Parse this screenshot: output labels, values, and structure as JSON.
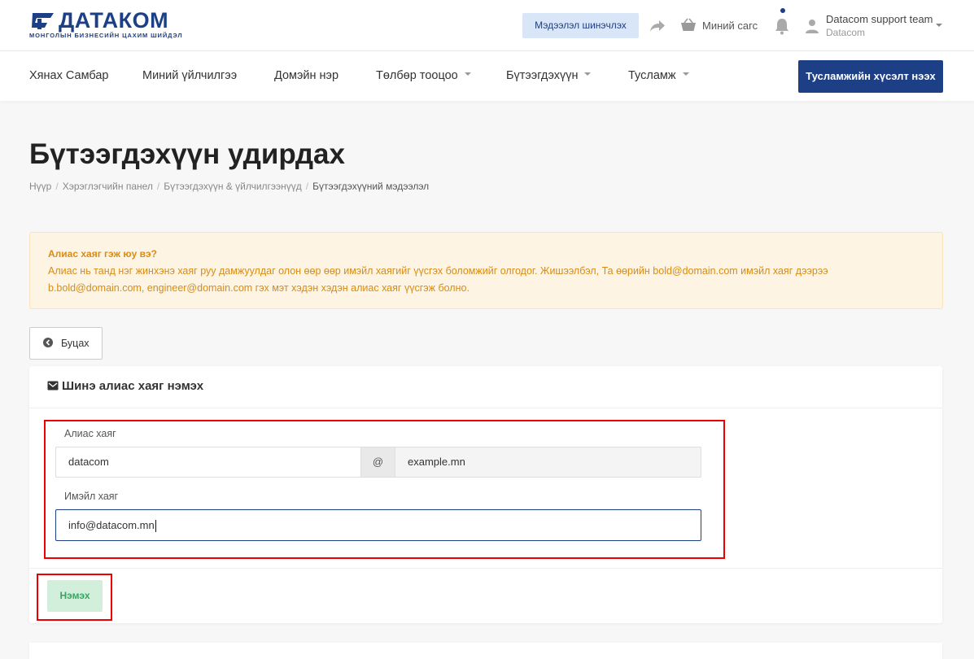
{
  "brand": {
    "name": "ДАТАКОМ",
    "tagline": "МОНГОЛЫН БИЗНЕСИЙН ЦАХИМ ШИЙДЭЛ",
    "color": "#1d3f86"
  },
  "topbar": {
    "refresh_label": "Мэдээлэл шинэчлэх",
    "cart_label": "Миний сагс",
    "user_name": "Datacom support team",
    "user_org": "Datacom"
  },
  "nav": {
    "items": [
      {
        "label": "Хянах Самбар"
      },
      {
        "label": "Миний үйлчилгээ"
      },
      {
        "label": "Домэйн нэр"
      },
      {
        "label": "Төлбөр тооцоо"
      },
      {
        "label": "Бүтээгдэхүүн"
      },
      {
        "label": "Тусламж"
      }
    ],
    "ticket_button": "Тусламжийн хүсэлт нээх"
  },
  "page": {
    "title": "Бүтээгдэхүүн удирдах",
    "breadcrumb": [
      "Нүүр",
      "Хэрэглэгчийн панел",
      "Бүтээгдэхүүн & үйлчилгээнүүд",
      "Бүтээгдэхүүний мэдээлэл"
    ]
  },
  "alert": {
    "title": "Алиас хаяг гэж юу вэ?",
    "body": "Алиас нь танд нэг жинхэнэ хаяг руу дамжуулдаг олон өөр өөр имэйл хаягийг үүсгэх боломжийг олгодог. Жишээлбэл, Та өөрийн bold@domain.com имэйл хаяг дээрээ b.bold@domain.com, engineer@domain.com гэх мэт хэдэн хэдэн алиас хаяг үүсгэж болно."
  },
  "back_button": "Буцах",
  "form": {
    "title": "Шинэ алиас хаяг нэмэх",
    "alias_label": "Алиас хаяг",
    "alias_value": "datacom",
    "at_symbol": "@",
    "domain_value": "example.mn",
    "email_label": "Имэйл хаяг",
    "email_value": "info@datacom.mn",
    "submit_label": "Нэмэх"
  }
}
